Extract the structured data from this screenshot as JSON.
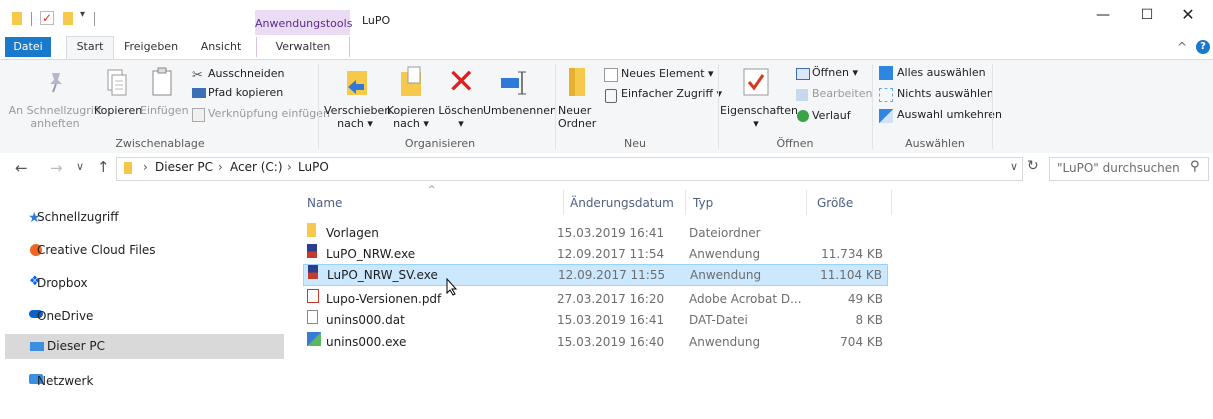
{
  "window": {
    "title": "LuPO",
    "context_tab": "Anwendungstools"
  },
  "tabs": {
    "datei": "Datei",
    "start": "Start",
    "freigeben": "Freigeben",
    "ansicht": "Ansicht",
    "verwalten": "Verwalten"
  },
  "ribbon": {
    "clipboard": {
      "pin_line1": "An Schnellzugriff",
      "pin_line2": "anheften",
      "copy": "Kopieren",
      "paste": "Einfügen",
      "cut": "Ausschneiden",
      "copy_path": "Pfad kopieren",
      "paste_shortcut": "Verknüpfung einfügen",
      "label": "Zwischenablage"
    },
    "organize": {
      "move_line1": "Verschieben",
      "move_line2": "nach",
      "copyto_line1": "Kopieren",
      "copyto_line2": "nach",
      "delete": "Löschen",
      "rename": "Umbenennen",
      "label": "Organisieren"
    },
    "new": {
      "folder_line1": "Neuer",
      "folder_line2": "Ordner",
      "new_item": "Neues Element",
      "easy_access": "Einfacher Zugriff",
      "label": "Neu"
    },
    "open": {
      "properties": "Eigenschaften",
      "open": "Öffnen",
      "edit": "Bearbeiten",
      "history": "Verlauf",
      "label": "Öffnen"
    },
    "select": {
      "select_all": "Alles auswählen",
      "select_none": "Nichts auswählen",
      "invert": "Auswahl umkehren",
      "label": "Auswählen"
    }
  },
  "address": {
    "crumb1": "Dieser PC",
    "crumb2": "Acer (C:)",
    "crumb3": "LuPO",
    "search_placeholder": "\"LuPO\" durchsuchen"
  },
  "nav": [
    {
      "label": "Schnellzugriff"
    },
    {
      "label": "Creative Cloud Files"
    },
    {
      "label": "Dropbox"
    },
    {
      "label": "OneDrive"
    },
    {
      "label": "Dieser PC"
    },
    {
      "label": "Netzwerk"
    }
  ],
  "columns": {
    "name": "Name",
    "date": "Änderungsdatum",
    "type": "Typ",
    "size": "Größe"
  },
  "files": [
    {
      "name": "Vorlagen",
      "date": "15.03.2019 16:41",
      "type": "Dateiordner",
      "size": ""
    },
    {
      "name": "LuPO_NRW.exe",
      "date": "12.09.2017 11:54",
      "type": "Anwendung",
      "size": "11.734 KB"
    },
    {
      "name": "LuPO_NRW_SV.exe",
      "date": "12.09.2017 11:55",
      "type": "Anwendung",
      "size": "11.104 KB"
    },
    {
      "name": "Lupo-Versionen.pdf",
      "date": "27.03.2017 16:20",
      "type": "Adobe Acrobat D...",
      "size": "49 KB"
    },
    {
      "name": "unins000.dat",
      "date": "15.03.2019 16:41",
      "type": "DAT-Datei",
      "size": "8 KB"
    },
    {
      "name": "unins000.exe",
      "date": "15.03.2019 16:40",
      "type": "Anwendung",
      "size": "704 KB"
    }
  ]
}
